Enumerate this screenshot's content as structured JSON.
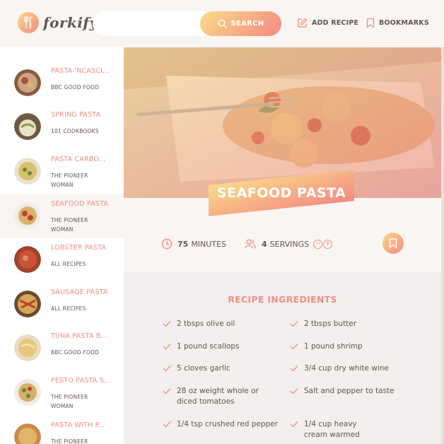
{
  "header": {
    "logo_text": "forkify",
    "search_placeholder": "",
    "search_button": "SEARCH",
    "add_recipe": "ADD RECIPE",
    "bookmarks": "BOOKMARKS"
  },
  "results": [
    {
      "title": "PASTA 'NCASCI...",
      "publisher": "BBC GOOD FOOD",
      "active": false
    },
    {
      "title": "SPRING PASTA",
      "publisher": "101 COOKBOOKS",
      "active": false
    },
    {
      "title": "PASTA CARBO...",
      "publisher": "THE PIONEER WOMAN",
      "active": false
    },
    {
      "title": "SEAFOOD PASTA",
      "publisher": "THE PIONEER WOMAN",
      "active": true
    },
    {
      "title": "LOBSTER PASTA",
      "publisher": "ALL RECIPES",
      "active": false
    },
    {
      "title": "SAUSAGE PASTA",
      "publisher": "ALL RECIPES",
      "active": false
    },
    {
      "title": "TUNA PASTA B...",
      "publisher": "BBC GOOD FOOD",
      "active": false
    },
    {
      "title": "PESTO PASTA S...",
      "publisher": "THE PIONEER WOMAN",
      "active": false
    },
    {
      "title": "PASTA WITH P...",
      "publisher": "THE PIONEER",
      "active": false
    }
  ],
  "recipe": {
    "title": "SEAFOOD PASTA",
    "minutes": "75",
    "minutes_label": "MINUTES",
    "servings": "4",
    "servings_label": "SERVINGS",
    "ingredients_heading": "RECIPE INGREDIENTS",
    "ingredients": [
      "2 tbsps olive oil",
      "2 tbsps butter",
      "1 pound scallops",
      "1 pound shrimp",
      "5 cloves garlic",
      "3/4 cup dry white wine",
      "28 oz weight whole or diced tomatoes",
      "Salt and pepper to taste",
      "1/4 tsp crushed red pepper",
      "1/4 cup heavy cream warmed"
    ]
  },
  "colors": {
    "accent": "#f38e82",
    "gradient_start": "#fbdb89",
    "gradient_end": "#f48982",
    "text": "#615551",
    "background": "#f9f5f3"
  },
  "icons": {
    "logo": "fork-knife-icon",
    "search": "search-icon",
    "add_recipe": "edit-icon",
    "bookmarks": "bookmark-icon",
    "minutes": "clock-icon",
    "servings": "users-icon",
    "ingredient": "check-icon"
  }
}
